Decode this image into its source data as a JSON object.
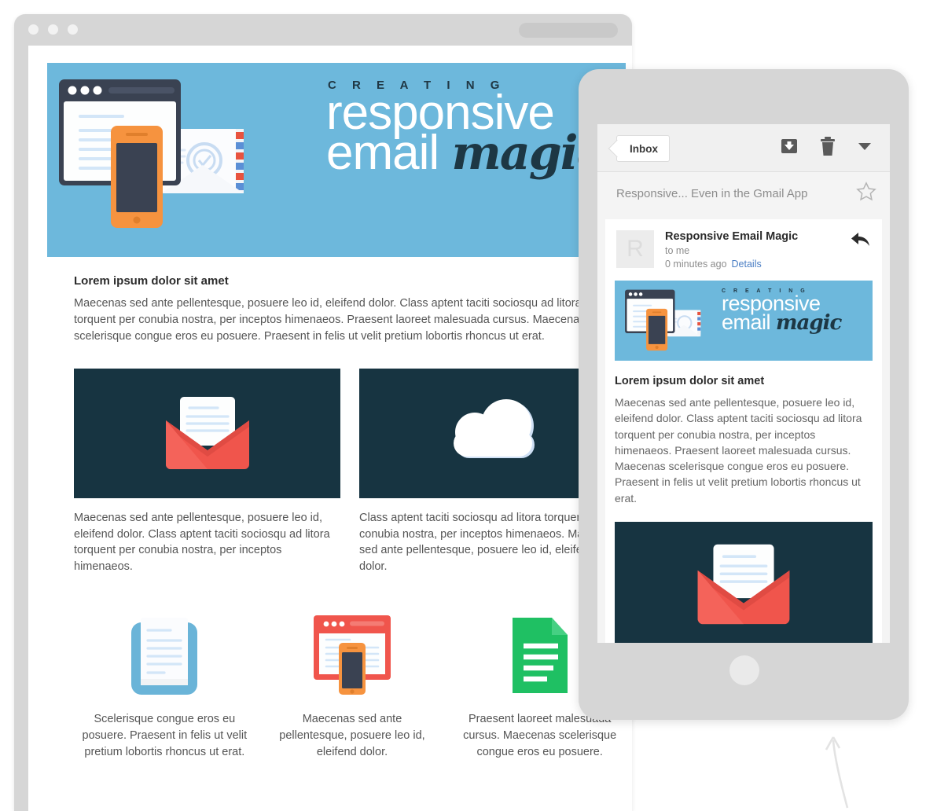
{
  "browser": {
    "dots": [
      "dot-1",
      "dot-2",
      "dot-3"
    ],
    "url_pill": ""
  },
  "hero": {
    "eyebrow": "C R E A T I N G",
    "line1": "responsive",
    "line2_a": "email ",
    "line2_b": "magic",
    "bg_color": "#6db8dc",
    "accent_dark": "#1d3744"
  },
  "desktop_email": {
    "heading": "Lorem ipsum dolor sit amet",
    "paragraph": "Maecenas sed ante pellentesque, posuere leo id, eleifend dolor. Class aptent taciti sociosqu ad litora torquent per conubia nostra, per inceptos himenaeos. Praesent laoreet malesuada cursus. Maecenas scelerisque congue eros eu posuere. Praesent in felis ut velit pretium lobortis rhoncus ut erat.",
    "panels": [
      {
        "name": "envelope-panel",
        "icon": "open-envelope-icon",
        "bg": "#173441"
      },
      {
        "name": "cloud-panel",
        "icon": "cloud-icon",
        "bg": "#173441"
      }
    ],
    "columns": [
      "Maecenas sed ante pellentesque, posuere leo id, eleifend dolor. Class aptent taciti sociosqu ad litora torquent per conubia nostra, per inceptos himenaeos.",
      "Class aptent taciti sociosqu ad litora torquent per conubia nostra, per inceptos himenaeos. Maecenas sed ante pellentesque, posuere leo id, eleifend dolor."
    ],
    "features": [
      {
        "icon": "document-stack-icon",
        "caption": "Scelerisque congue eros eu posuere. Praesent in felis ut velit pretium lobortis rhoncus ut erat."
      },
      {
        "icon": "responsive-browser-phone-icon",
        "caption": "Maecenas sed ante pellentesque, posuere leo id, eleifend dolor."
      },
      {
        "icon": "green-document-icon",
        "caption": "Praesent laoreet malesuada cursus. Maecenas scelerisque congue eros eu posuere."
      }
    ]
  },
  "phone": {
    "gmail_toolbar": {
      "back_label": "Inbox",
      "archive_icon": "archive-icon",
      "delete_icon": "trash-icon",
      "more_icon": "chevron-down-icon"
    },
    "subject": "Responsive... Even in the Gmail App",
    "star_icon": "star-outline-icon",
    "message": {
      "avatar_letter": "R",
      "sender": "Responsive Email Magic",
      "recipient": "to me",
      "time": "0 minutes ago",
      "details_link": "Details",
      "reply_icon": "reply-arrow-icon"
    },
    "body": {
      "heading": "Lorem ipsum dolor sit amet",
      "paragraph": "Maecenas sed ante pellentesque, posuere leo id, eleifend dolor. Class aptent taciti sociosqu ad litora torquent per conubia nostra, per inceptos himenaeos. Praesent laoreet malesuada cursus. Maecenas scelerisque congue eros eu posuere. Praesent in felis ut velit pretium lobortis rhoncus ut erat."
    }
  }
}
